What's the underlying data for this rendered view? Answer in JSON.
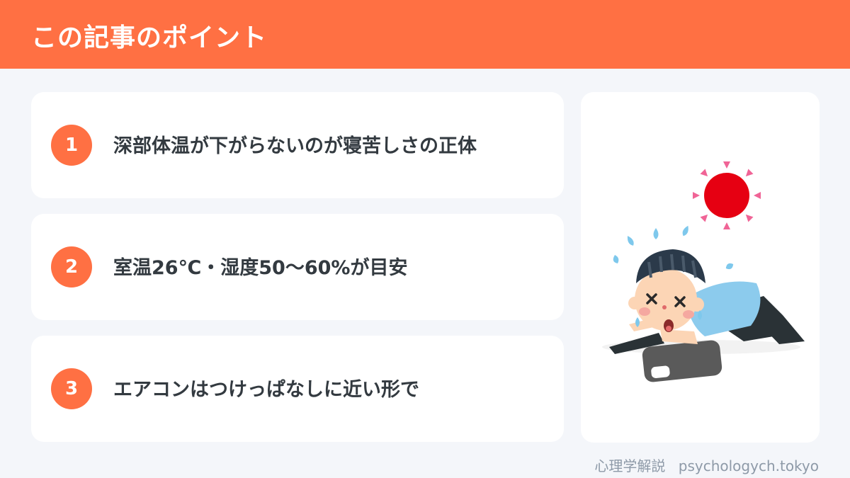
{
  "header": {
    "title": "この記事のポイント"
  },
  "points": [
    {
      "number": "1",
      "text": "深部体温が下がらないのが寝苦しさの正体"
    },
    {
      "number": "2",
      "text": "室温26℃・湿度50〜60%が目安"
    },
    {
      "number": "3",
      "text": "エアコンはつけっぱなしに近い形で"
    }
  ],
  "illustration": {
    "icon": "heatstroke-person-icon"
  },
  "footer": {
    "site_name": "心理学解説",
    "domain": "psychologych.tokyo"
  },
  "colors": {
    "accent": "#ff7043",
    "background": "#f4f6fa",
    "card": "#ffffff",
    "text": "#333a40",
    "footer_text": "#8e9aa8"
  }
}
